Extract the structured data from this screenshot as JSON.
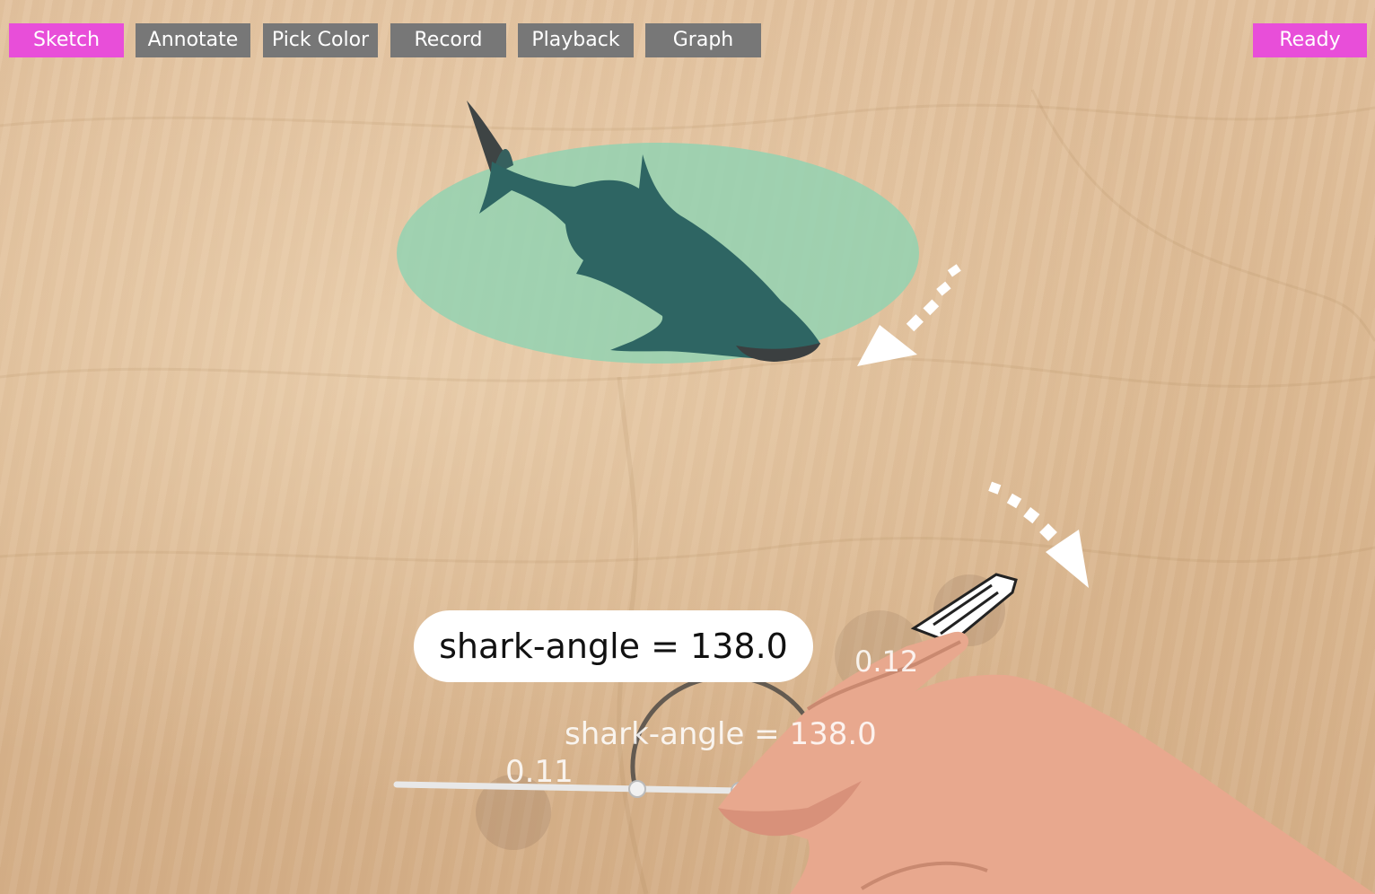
{
  "toolbar": {
    "sketch": "Sketch",
    "annotate": "Annotate",
    "pick_color": "Pick Color",
    "record": "Record",
    "playback": "Playback",
    "graph": "Graph",
    "status": "Ready",
    "accent_color": "#e84ed9",
    "button_color": "#777777"
  },
  "callout": {
    "text": "shark-angle = 138.0"
  },
  "ar_labels": {
    "angle": "shark-angle = 138.0",
    "segment_a": "0.11",
    "segment_b": "0.12"
  }
}
